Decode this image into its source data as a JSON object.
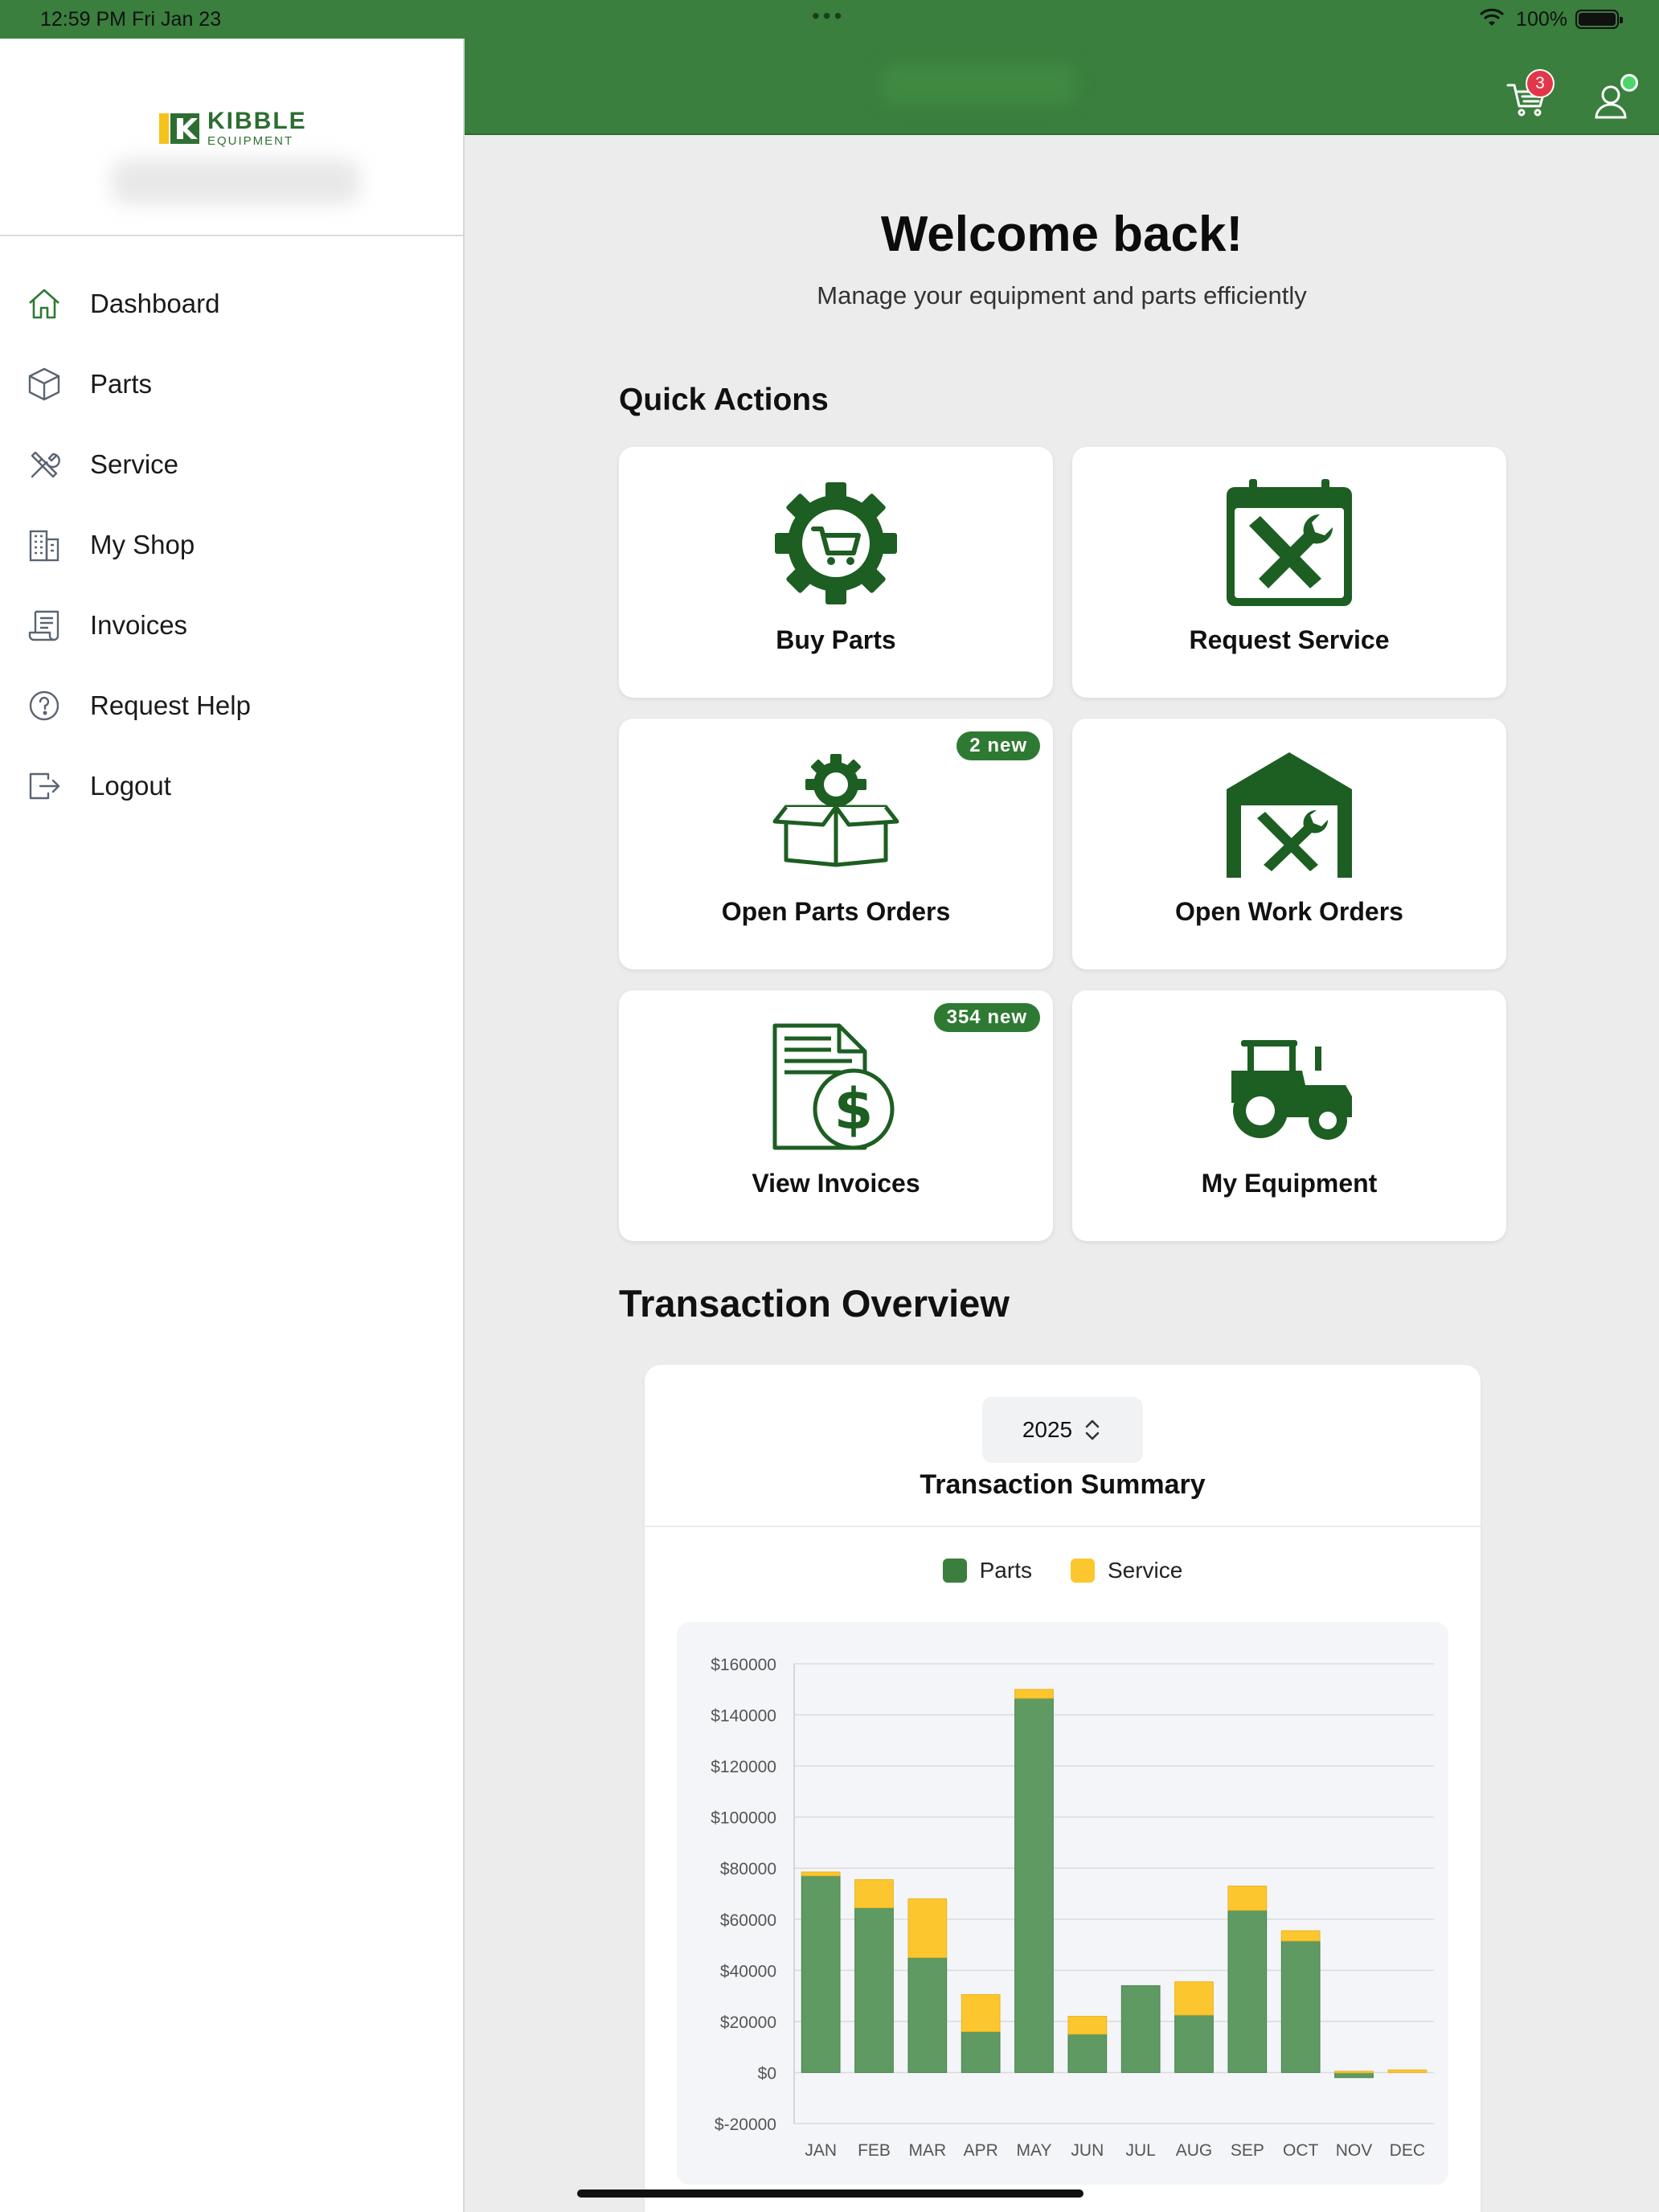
{
  "status_bar": {
    "time": "12:59 PM   Fri Jan 23",
    "dots": "•••",
    "battery": "100%"
  },
  "header": {
    "cart_count": "3"
  },
  "brand": {
    "name": "KIBBLE",
    "sub": "EQUIPMENT"
  },
  "sidebar": {
    "items": [
      {
        "label": "Dashboard",
        "icon": "home-icon"
      },
      {
        "label": "Parts",
        "icon": "box-icon"
      },
      {
        "label": "Service",
        "icon": "tools-icon"
      },
      {
        "label": "My Shop",
        "icon": "building-icon"
      },
      {
        "label": "Invoices",
        "icon": "receipt-icon"
      },
      {
        "label": "Request Help",
        "icon": "help-circle-icon"
      },
      {
        "label": "Logout",
        "icon": "logout-icon"
      }
    ]
  },
  "main": {
    "welcome": "Welcome back!",
    "subtitle": "Manage your equipment and parts efficiently",
    "quick_actions_title": "Quick Actions",
    "quick_actions": [
      {
        "label": "Buy Parts",
        "icon": "gear-cart-icon",
        "badge": ""
      },
      {
        "label": "Request Service",
        "icon": "calendar-tools-icon",
        "badge": ""
      },
      {
        "label": "Open Parts Orders",
        "icon": "gear-box-icon",
        "badge": "2 new"
      },
      {
        "label": "Open Work Orders",
        "icon": "garage-tools-icon",
        "badge": ""
      },
      {
        "label": "View Invoices",
        "icon": "invoice-dollar-icon",
        "badge": "354 new"
      },
      {
        "label": "My Equipment",
        "icon": "tractor-icon",
        "badge": ""
      }
    ],
    "overview_title": "Transaction Overview",
    "year": "2025"
  },
  "colors": {
    "brand_green": "#3a7f3d",
    "parts": "#5e9a62",
    "service": "#fcc72e",
    "badge_red": "#e3364a"
  },
  "chart_data": {
    "type": "bar",
    "stacked": true,
    "title": "Transaction Summary",
    "categories": [
      "JAN",
      "FEB",
      "MAR",
      "APR",
      "MAY",
      "JUN",
      "JUL",
      "AUG",
      "SEP",
      "OCT",
      "NOV",
      "DEC"
    ],
    "series": [
      {
        "name": "Parts",
        "values": [
          77000,
          64500,
          45000,
          16000,
          146500,
          15000,
          34000,
          22500,
          63500,
          51500,
          -2000,
          0
        ]
      },
      {
        "name": "Service",
        "values": [
          1500,
          11000,
          23000,
          14500,
          3500,
          7000,
          0,
          13000,
          9500,
          4000,
          500,
          1000
        ]
      }
    ],
    "ylim": [
      -20000,
      160000
    ],
    "yticks": [
      160000,
      140000,
      120000,
      100000,
      80000,
      60000,
      40000,
      20000,
      0,
      -20000
    ],
    "ytick_labels": [
      "$160000",
      "$140000",
      "$120000",
      "$100000",
      "$80000",
      "$60000",
      "$40000",
      "$20000",
      "$0",
      "$-20000"
    ],
    "legend": "top-center",
    "grid": true
  }
}
